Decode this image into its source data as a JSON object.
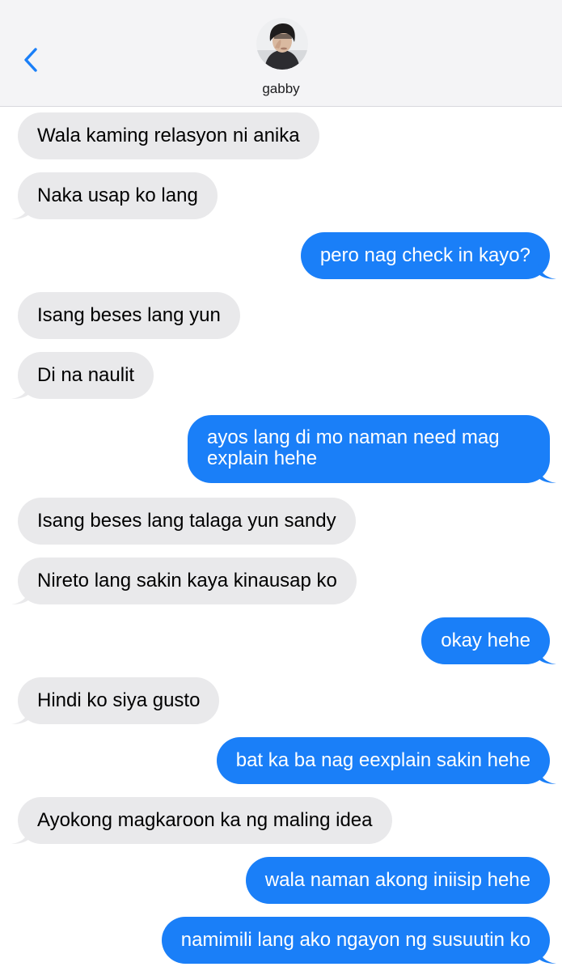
{
  "header": {
    "contact_name": "gabby",
    "back_icon": "chevron-left-icon",
    "accent_color": "#1a7ff8"
  },
  "messages": [
    {
      "from": "them",
      "text": "Wala kaming relasyon ni anika"
    },
    {
      "from": "them",
      "text": "Naka usap ko lang"
    },
    {
      "from": "me",
      "text": "pero nag check in kayo?"
    },
    {
      "from": "them",
      "text": "Isang beses lang yun"
    },
    {
      "from": "them",
      "text": "Di na naulit"
    },
    {
      "from": "me",
      "text": "ayos lang di mo naman need mag explain hehe"
    },
    {
      "from": "them",
      "text": "Isang beses lang talaga yun sandy"
    },
    {
      "from": "them",
      "text": "Nireto lang sakin kaya kinausap ko"
    },
    {
      "from": "me",
      "text": "okay hehe"
    },
    {
      "from": "them",
      "text": "Hindi ko siya gusto"
    },
    {
      "from": "me",
      "text": "bat ka ba nag eexplain sakin hehe"
    },
    {
      "from": "them",
      "text": "Ayokong magkaroon ka ng maling idea"
    },
    {
      "from": "me",
      "text": "wala naman akong iniisip hehe"
    },
    {
      "from": "me",
      "text": "namimili lang ako ngayon ng susuutin ko"
    }
  ],
  "colors": {
    "incoming_bubble": "#e9e9eb",
    "outgoing_bubble": "#1a7ff8",
    "header_background": "#f4f4f6"
  }
}
